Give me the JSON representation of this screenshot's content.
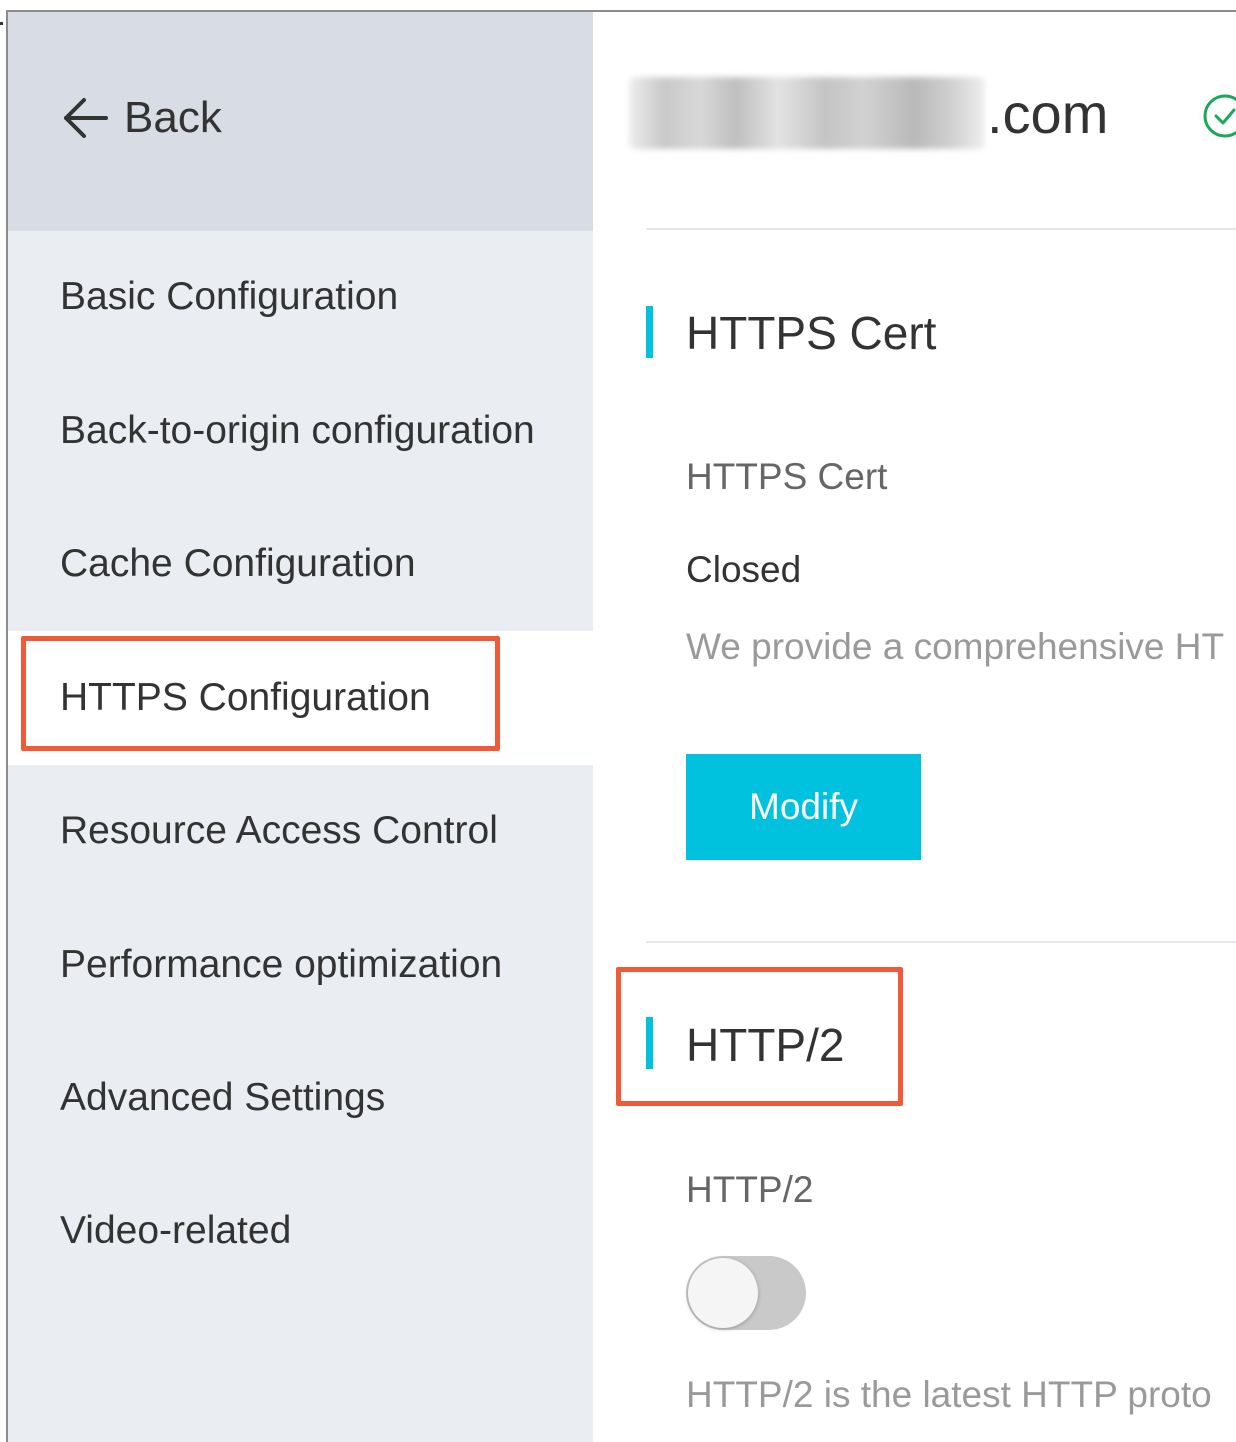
{
  "sidebar": {
    "back_label": "Back",
    "items": [
      {
        "label": "Basic Configuration"
      },
      {
        "label": "Back-to-origin configuration"
      },
      {
        "label": "Cache Configuration"
      },
      {
        "label": "HTTPS Configuration",
        "active": true
      },
      {
        "label": "Resource Access Control"
      },
      {
        "label": "Performance optimization"
      },
      {
        "label": "Advanced Settings"
      },
      {
        "label": "Video-related"
      }
    ]
  },
  "header": {
    "domain_suffix": ".com",
    "status_icon": "check-circle-icon"
  },
  "sections": {
    "https_cert": {
      "title": "HTTPS Cert",
      "field_label": "HTTPS Cert",
      "status": "Closed",
      "description": "We provide a comprehensive HT",
      "button_label": "Modify"
    },
    "http2": {
      "title": "HTTP/2",
      "field_label": "HTTP/2",
      "enabled": false,
      "description": "HTTP/2 is the latest HTTP proto"
    }
  },
  "colors": {
    "accent": "#00c1de",
    "highlight": "#f05a38",
    "sidebar_bg": "#eaedf1",
    "sidebar_header_bg": "#d8dde5"
  }
}
